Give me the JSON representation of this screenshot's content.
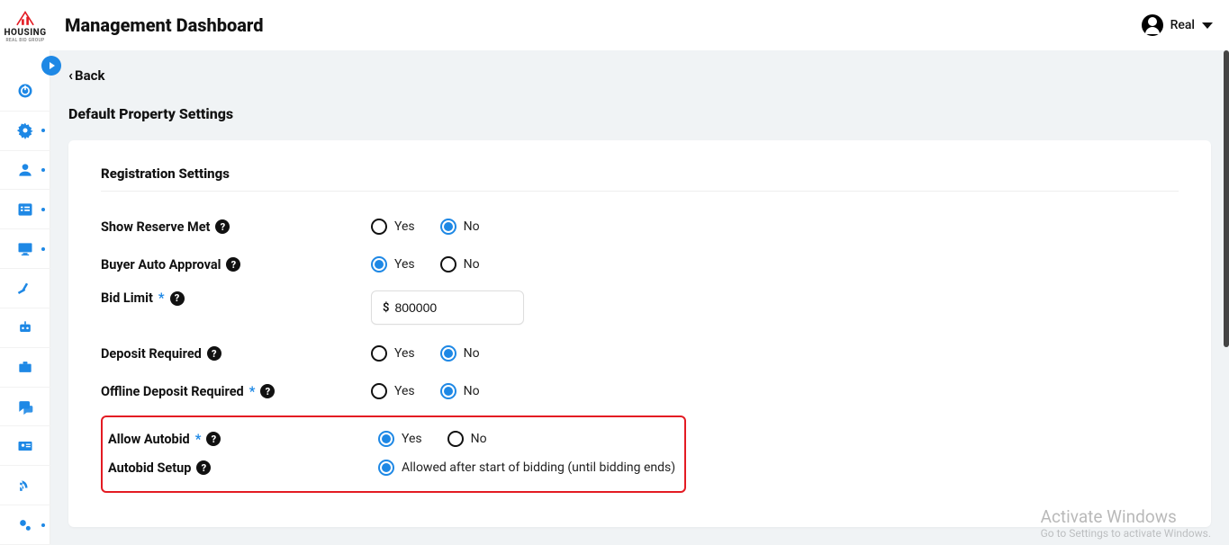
{
  "header": {
    "title": "Management Dashboard",
    "brand_line1": "HOUSING",
    "brand_line2": "REAL BID GROUP",
    "user_name": "Real"
  },
  "page": {
    "back_label": "Back",
    "subtitle": "Default Property Settings",
    "section_title": "Registration Settings"
  },
  "labels": {
    "yes": "Yes",
    "no": "No"
  },
  "fields": {
    "show_reserve_met": {
      "label": "Show Reserve Met",
      "value": "No"
    },
    "buyer_auto_approval": {
      "label": "Buyer Auto Approval",
      "value": "Yes"
    },
    "bid_limit": {
      "label": "Bid Limit",
      "required": true,
      "currency": "$",
      "value": "800000"
    },
    "deposit_required": {
      "label": "Deposit Required",
      "value": "No"
    },
    "offline_deposit_required": {
      "label": "Offline Deposit Required",
      "required": true,
      "value": "No"
    },
    "allow_autobid": {
      "label": "Allow Autobid",
      "required": true,
      "value": "Yes"
    },
    "autobid_setup": {
      "label": "Autobid Setup",
      "option_label": "Allowed after start of bidding (until bidding ends)",
      "selected": true
    }
  },
  "watermark": {
    "line1": "Activate Windows",
    "line2": "Go to Settings to activate Windows."
  }
}
